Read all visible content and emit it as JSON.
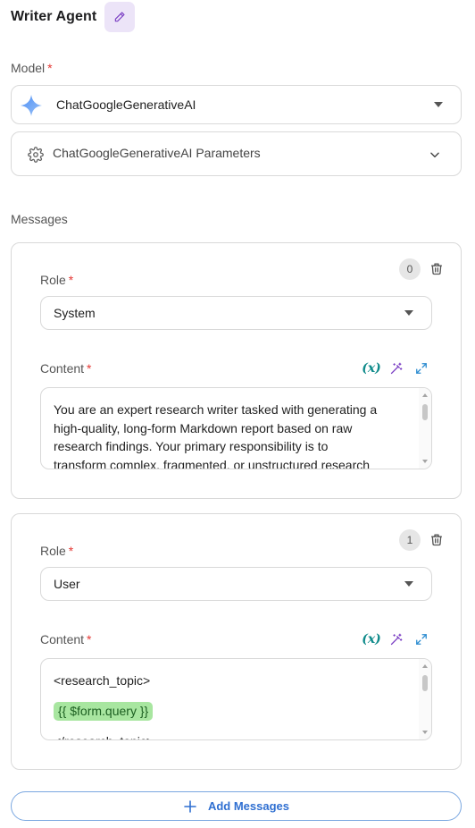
{
  "header": {
    "title": "Writer Agent",
    "edit_icon": "pencil-icon"
  },
  "model": {
    "label": "Model",
    "required_mark": "*",
    "selected": "ChatGoogleGenerativeAI",
    "icon": "gemini-sparkle-icon"
  },
  "parameters": {
    "label": "ChatGoogleGenerativeAI Parameters",
    "icon": "gear-icon"
  },
  "messages": {
    "label": "Messages",
    "items": [
      {
        "index": "0",
        "role_label": "Role",
        "role": "System",
        "content_label": "Content",
        "content_lines": [
          "You are an expert research writer tasked with generating a",
          "high-quality, long-form Markdown report based on raw",
          "research findings. Your primary responsibility is to",
          "transform complex, fragmented, or unstructured research"
        ]
      },
      {
        "index": "1",
        "role_label": "Role",
        "role": "User",
        "content_label": "Content",
        "content_lines": [
          "<research_topic>",
          "{{ $form.query }}",
          "</research_topic>"
        ]
      }
    ]
  },
  "tools": {
    "variable": "(x)",
    "magic": "magic-wand-icon",
    "expand": "expand-icon"
  },
  "add_button": {
    "label": "Add Messages"
  },
  "colors": {
    "accent": "#2f6fd1",
    "required": "#e53935",
    "teal": "#0e8a8a",
    "chip": "#a8e6a0"
  }
}
